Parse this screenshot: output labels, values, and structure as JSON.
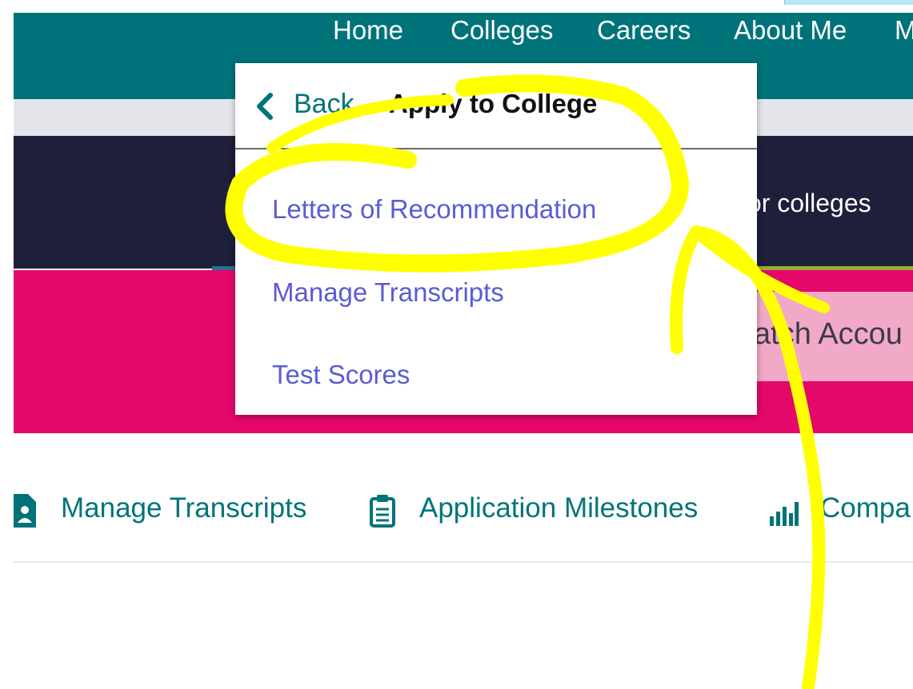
{
  "topnav": {
    "items": [
      "Home",
      "Colleges",
      "Careers",
      "About Me",
      "M"
    ]
  },
  "banner": {
    "partial_text": "for colleges"
  },
  "search": {
    "partial_text": "atch Accou"
  },
  "dropdown": {
    "back_label": "Back",
    "title": "Apply to College",
    "items": [
      "Letters of Recommendation",
      "Manage Transcripts",
      "Test Scores"
    ]
  },
  "subnav": {
    "items": [
      {
        "label": "Manage Transcripts",
        "icon": "document-user-icon"
      },
      {
        "label": "Application Milestones",
        "icon": "clipboard-icon"
      },
      {
        "label": "Compa",
        "icon": "bar-chart-icon"
      }
    ]
  },
  "colors": {
    "teal": "#00737a",
    "navy": "#1e1f3a",
    "pink": "#e4086a",
    "link_purple": "#5a5cd4",
    "highlight_yellow": "#ffff00"
  }
}
